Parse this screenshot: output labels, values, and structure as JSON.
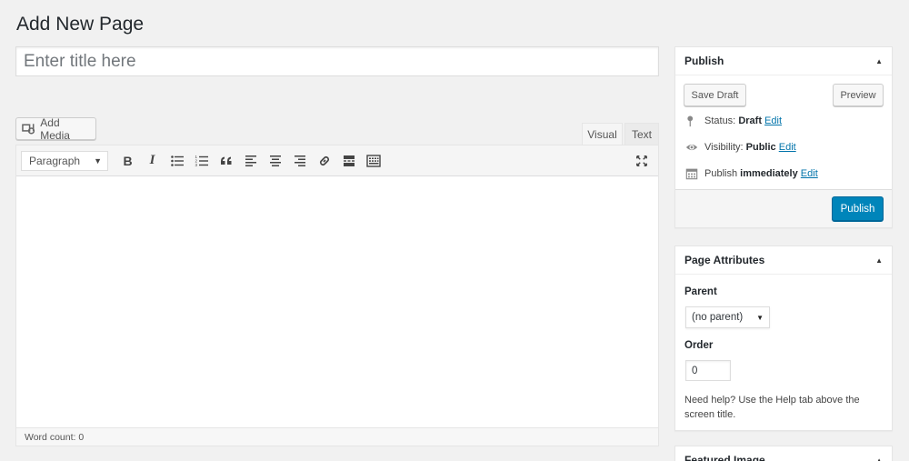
{
  "page": {
    "title": "Add New Page"
  },
  "title_field": {
    "placeholder": "Enter title here",
    "value": ""
  },
  "media": {
    "add_media_label": "Add Media"
  },
  "editor": {
    "tabs": {
      "visual": "Visual",
      "text": "Text"
    },
    "format_select": "Paragraph",
    "toolbar": [
      "bold-icon",
      "italic-icon",
      "bullet-list-icon",
      "numbered-list-icon",
      "blockquote-icon",
      "align-left-icon",
      "align-center-icon",
      "align-right-icon",
      "link-icon",
      "read-more-icon",
      "toolbar-toggle-icon",
      "fullscreen-icon"
    ],
    "bold_label": "B",
    "italic_label": "I",
    "word_count": "Word count: 0"
  },
  "publish_box": {
    "title": "Publish",
    "save_draft": "Save Draft",
    "preview": "Preview",
    "status_label": "Status:",
    "status_value": "Draft",
    "visibility_label": "Visibility:",
    "visibility_value": "Public",
    "publish_label": "Publish",
    "publish_value": "immediately",
    "edit": "Edit",
    "publish_button": "Publish"
  },
  "page_attributes": {
    "title": "Page Attributes",
    "parent_label": "Parent",
    "parent_value": "(no parent)",
    "order_label": "Order",
    "order_value": "0",
    "help": "Need help? Use the Help tab above the screen title."
  },
  "featured_image": {
    "title": "Featured Image"
  },
  "colors": {
    "primary": "#0085ba",
    "link": "#0073aa",
    "background": "#f1f1f1"
  }
}
